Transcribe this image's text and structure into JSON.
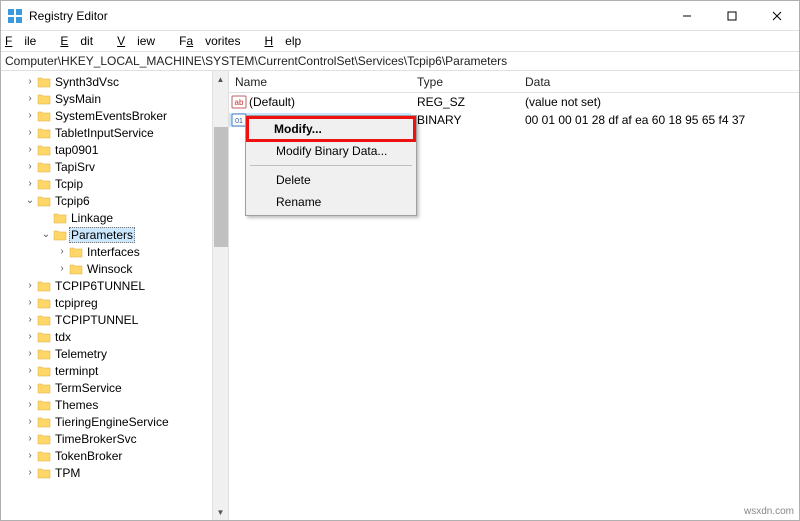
{
  "window": {
    "title": "Registry Editor"
  },
  "menu": {
    "file": "File",
    "edit": "Edit",
    "view": "View",
    "favorites": "Favorites",
    "help": "Help"
  },
  "address": "Computer\\HKEY_LOCAL_MACHINE\\SYSTEM\\CurrentControlSet\\Services\\Tcpip6\\Parameters",
  "tree": {
    "items": [
      {
        "indent": 1,
        "twisty": ">",
        "label": "Synth3dVsc"
      },
      {
        "indent": 1,
        "twisty": ">",
        "label": "SysMain"
      },
      {
        "indent": 1,
        "twisty": ">",
        "label": "SystemEventsBroker"
      },
      {
        "indent": 1,
        "twisty": ">",
        "label": "TabletInputService"
      },
      {
        "indent": 1,
        "twisty": ">",
        "label": "tap0901"
      },
      {
        "indent": 1,
        "twisty": ">",
        "label": "TapiSrv"
      },
      {
        "indent": 1,
        "twisty": ">",
        "label": "Tcpip"
      },
      {
        "indent": 1,
        "twisty": "v",
        "label": "Tcpip6"
      },
      {
        "indent": 2,
        "twisty": "",
        "label": "Linkage"
      },
      {
        "indent": 2,
        "twisty": "v",
        "label": "Parameters",
        "selected": true
      },
      {
        "indent": 3,
        "twisty": ">",
        "label": "Interfaces"
      },
      {
        "indent": 3,
        "twisty": ">",
        "label": "Winsock"
      },
      {
        "indent": 1,
        "twisty": ">",
        "label": "TCPIP6TUNNEL"
      },
      {
        "indent": 1,
        "twisty": ">",
        "label": "tcpipreg"
      },
      {
        "indent": 1,
        "twisty": ">",
        "label": "TCPIPTUNNEL"
      },
      {
        "indent": 1,
        "twisty": ">",
        "label": "tdx"
      },
      {
        "indent": 1,
        "twisty": ">",
        "label": "Telemetry"
      },
      {
        "indent": 1,
        "twisty": ">",
        "label": "terminpt"
      },
      {
        "indent": 1,
        "twisty": ">",
        "label": "TermService"
      },
      {
        "indent": 1,
        "twisty": ">",
        "label": "Themes"
      },
      {
        "indent": 1,
        "twisty": ">",
        "label": "TieringEngineService"
      },
      {
        "indent": 1,
        "twisty": ">",
        "label": "TimeBrokerSvc"
      },
      {
        "indent": 1,
        "twisty": ">",
        "label": "TokenBroker"
      },
      {
        "indent": 1,
        "twisty": ">",
        "label": "TPM"
      }
    ]
  },
  "list": {
    "columns": {
      "name": "Name",
      "type": "Type",
      "data": "Data"
    },
    "rows": [
      {
        "icon": "str",
        "name": "(Default)",
        "type": "REG_SZ",
        "data": "(value not set)",
        "selected": false
      },
      {
        "icon": "bin",
        "name": "",
        "type": "BINARY",
        "data": "00 01 00 01 28 df af ea 60 18 95 65 f4 37",
        "selected": true
      }
    ]
  },
  "context_menu": {
    "modify": "Modify...",
    "modify_binary": "Modify Binary Data...",
    "delete": "Delete",
    "rename": "Rename"
  },
  "watermark": "wsxdn.com"
}
